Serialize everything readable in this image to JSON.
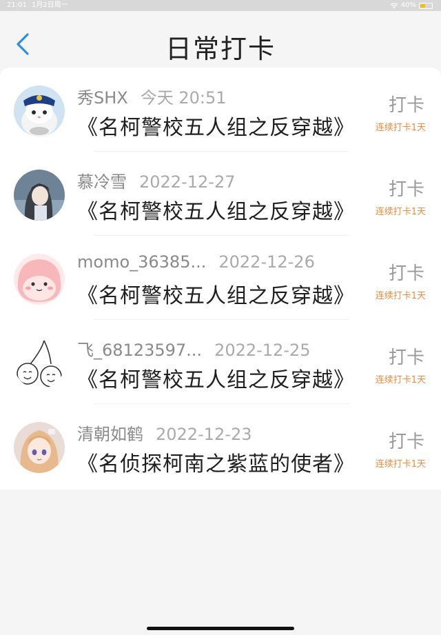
{
  "status_bar": {
    "time": "21:01",
    "date": "1月2日周一",
    "battery": "40%"
  },
  "header": {
    "title": "日常打卡"
  },
  "checkins": [
    {
      "username": "秀SHX",
      "timestamp": "今天 20:51",
      "book": "《名柯警校五人组之反穿越》",
      "button_label": "打卡",
      "streak": "连续打卡1天"
    },
    {
      "username": "慕冷雪",
      "timestamp": "2022-12-27",
      "book": "《名柯警校五人组之反穿越》",
      "button_label": "打卡",
      "streak": "连续打卡1天"
    },
    {
      "username": "momo_36385...",
      "timestamp": "2022-12-26",
      "book": "《名柯警校五人组之反穿越》",
      "button_label": "打卡",
      "streak": "连续打卡1天"
    },
    {
      "username": "飞_68123597...",
      "timestamp": "2022-12-25",
      "book": "《名柯警校五人组之反穿越》",
      "button_label": "打卡",
      "streak": "连续打卡1天"
    },
    {
      "username": "清朝如鹤",
      "timestamp": "2022-12-23",
      "book": "《名侦探柯南之紫蓝的使者》",
      "button_label": "打卡",
      "streak": "连续打卡1天"
    }
  ],
  "colors": {
    "accent_back": "#2e8fe0",
    "streak": "#ef8b3c"
  }
}
